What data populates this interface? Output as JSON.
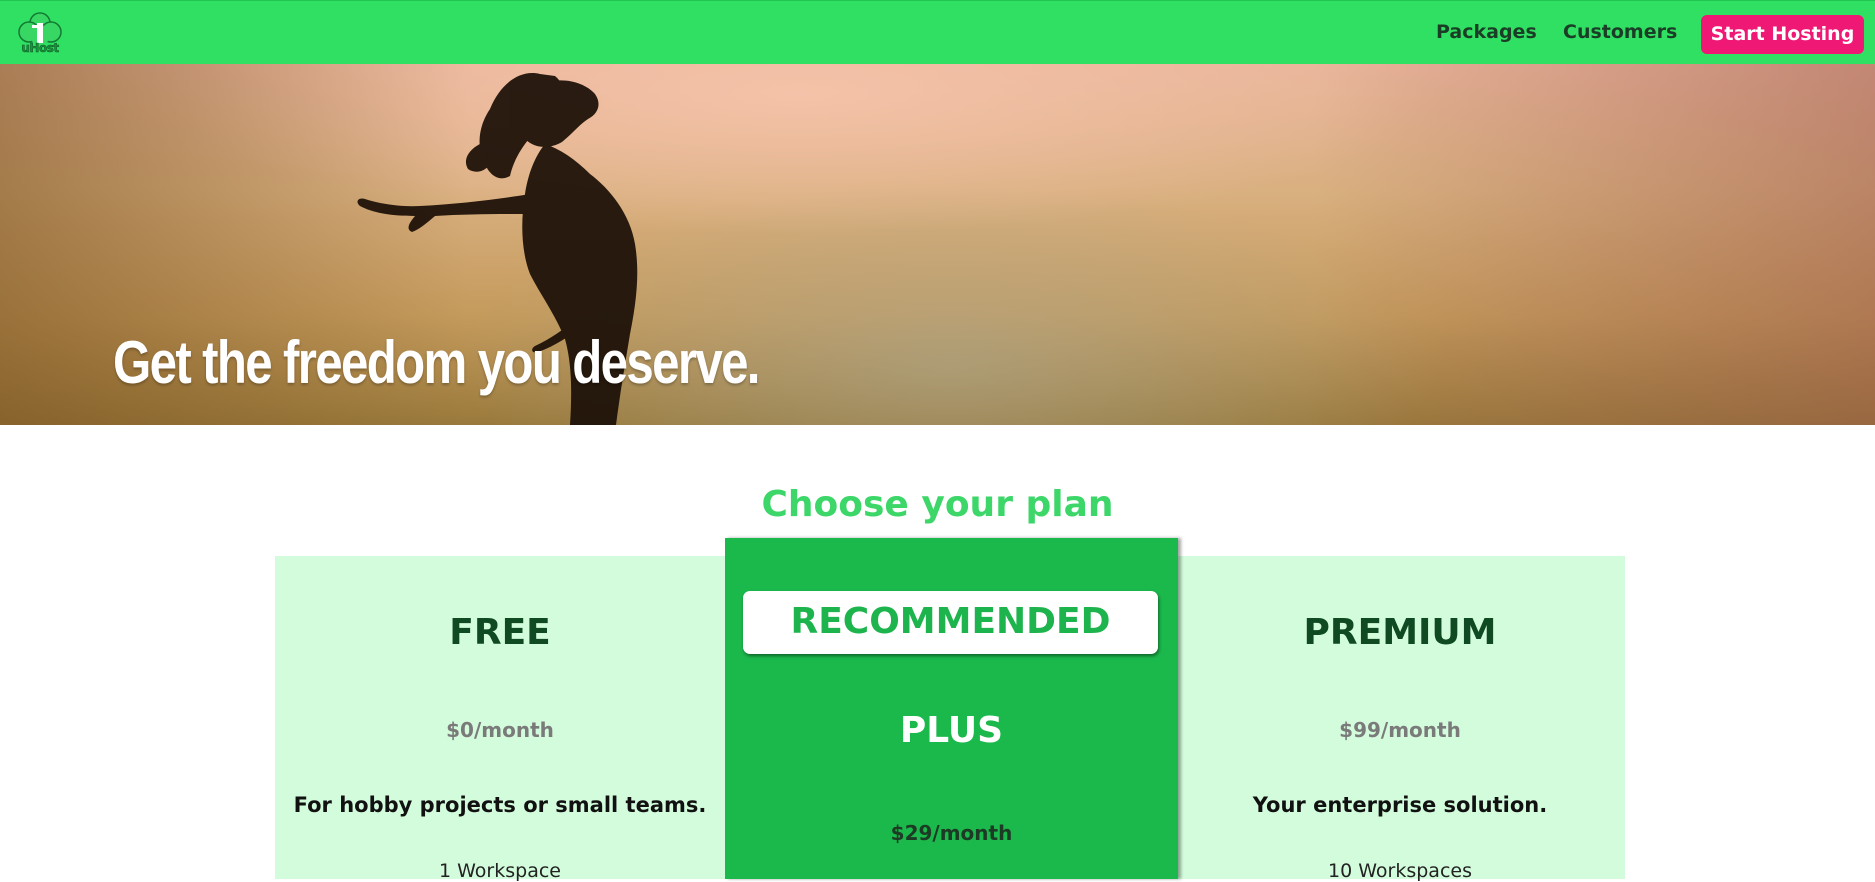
{
  "nav": {
    "logo_text": "uHost",
    "links": [
      "Packages",
      "Customers"
    ],
    "cta_label": "Start Hosting",
    "bg_color": "#2fe063",
    "cta_color": "#f01875"
  },
  "hero": {
    "title": "Get the freedom you deserve."
  },
  "pricing": {
    "title": "Choose your plan",
    "plans": [
      {
        "name": "FREE",
        "price": "$0/month",
        "description": "For hobby projects or small teams.",
        "feature": "1 Workspace"
      },
      {
        "badge": "RECOMMENDED",
        "name": "PLUS",
        "price": "$29/month"
      },
      {
        "name": "PREMIUM",
        "price": "$99/month",
        "description": "Your enterprise solution.",
        "feature": "10 Workspaces"
      }
    ]
  },
  "icons": {
    "logo": "tree-logo-icon"
  }
}
